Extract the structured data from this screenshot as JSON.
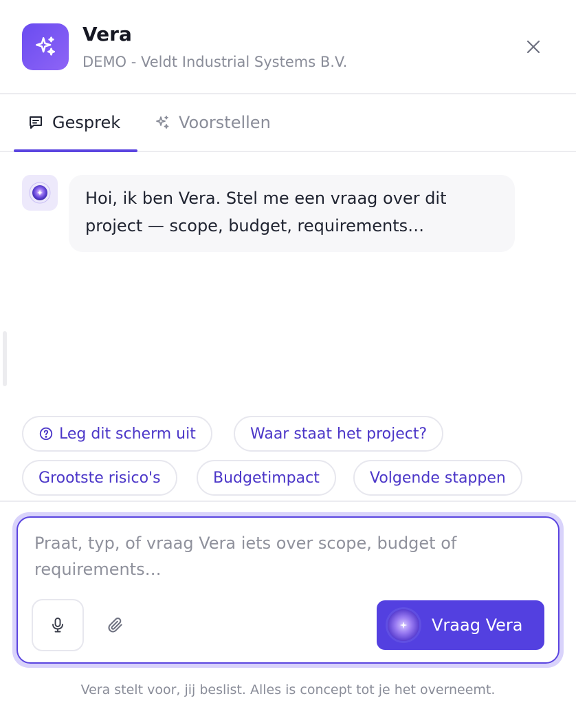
{
  "header": {
    "title": "Vera",
    "subtitle": "DEMO - Veldt Industrial Systems B.V.",
    "logo_icon": "sparkles-icon",
    "close_icon": "close-icon"
  },
  "tabs": [
    {
      "label": "Gesprek",
      "icon": "chat-icon",
      "active": true
    },
    {
      "label": "Voorstellen",
      "icon": "sparkles-icon",
      "active": false
    }
  ],
  "messages": [
    {
      "role": "assistant",
      "text": "Hoi, ik ben Vera. Stel me een vraag over dit project — scope, budget, requirements…"
    }
  ],
  "suggestions": [
    {
      "label": "Leg dit scherm uit",
      "icon": "question-circle-icon"
    },
    {
      "label": "Waar staat het project?"
    },
    {
      "label": "Grootste risico's"
    },
    {
      "label": "Budgetimpact"
    },
    {
      "label": "Volgende stappen"
    }
  ],
  "composer": {
    "placeholder": "Praat, typ, of vraag Vera iets over scope, budget of requirements…",
    "mic_icon": "microphone-icon",
    "attach_icon": "paperclip-icon",
    "submit_label": "Vraag Vera"
  },
  "footer": {
    "note": "Vera stelt voor, jij beslist. Alles is concept tot je het overneemt."
  },
  "colors": {
    "accent": "#5340e0",
    "accent_light": "#d9d3fb",
    "chip_text": "#4b36c8",
    "muted_text": "#8a8d99"
  }
}
